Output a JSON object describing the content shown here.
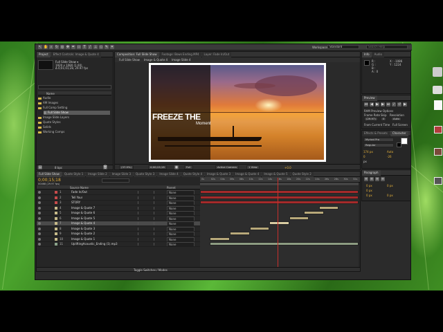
{
  "workspace": {
    "label": "Workspace:",
    "value": "Standard",
    "search_placeholder": "Search Help"
  },
  "project": {
    "tabs": [
      "Project",
      "Effect Controls: Image & Quote 4"
    ],
    "item_name": "Full Slide Show ▾",
    "item_info": [
      "1920 x 1080 (1.00)",
      "Δ 0;01;01;28, 29.97 fps"
    ],
    "search_value": "",
    "col_name": "Name",
    "items": [
      {
        "label": "Audio",
        "type": "folder",
        "indent": 0
      },
      {
        "label": "AM Images",
        "type": "folder",
        "indent": 0
      },
      {
        "label": "Full Comp Setting",
        "type": "folder",
        "indent": 0
      },
      {
        "label": "Full Slide Show",
        "type": "comp",
        "indent": 1,
        "selected": true
      },
      {
        "label": "Image Slide Layers",
        "type": "folder",
        "indent": 0
      },
      {
        "label": "Quote Styles",
        "type": "folder",
        "indent": 0
      },
      {
        "label": "Solids",
        "type": "folder",
        "indent": 0
      },
      {
        "label": "Working Comps",
        "type": "folder",
        "indent": 0
      }
    ],
    "footer": "8 bpc"
  },
  "composition": {
    "tabs": [
      "Composition: Full Slide Show",
      "Footage: Bows Ending.MP4",
      "Layer: Fade In/Out"
    ],
    "subtabs": [
      "Full Slide Show",
      "Image & Quote 4",
      "Image Slide 4"
    ],
    "headline": "FREEZE THE",
    "subline": "Moment",
    "zoom": "(37.9%)",
    "timecode": "0;00;15;18",
    "resolution": "Full",
    "camera": "Active Camera",
    "views": "1 View",
    "offset": "+0.0"
  },
  "info": {
    "tabs": [
      "Info",
      "Audio"
    ],
    "r": "R :",
    "g": "G :",
    "b": "B :",
    "a": "A : 0",
    "x": "X : -1086",
    "y": "Y : 1224"
  },
  "preview": {
    "title": "Preview",
    "ram_options": "RAM Preview Options",
    "frame_rate_label": "Frame Rate",
    "skip_label": "Skip",
    "resolution_label": "Resolution",
    "frame_rate": "(29.97)",
    "skip": "0",
    "resolution": "Auto",
    "from_current": "From Current Time",
    "full_screen": "Full Screen"
  },
  "character": {
    "tabs": [
      "Effects & Presets",
      "Character"
    ],
    "font": "Myriad Pro",
    "style": "Regular",
    "size": "174 px",
    "leading": "Auto",
    "tracking": "0",
    "tsume": "-26",
    "px_label": "px"
  },
  "paragraph": {
    "title": "Paragraph",
    "fields": [
      "0 px",
      "0 px",
      "0 px",
      "0 px",
      "0 px"
    ]
  },
  "timeline": {
    "tabs": [
      "Full Slide Show",
      "Quote Style 1",
      "Image Slide 2",
      "Image Slide 3",
      "Quote Style 3",
      "Image Slide 4",
      "Quote Style 4",
      "Image & Quote 3",
      "Image & Quote 4",
      "Image & Quote 5",
      "Quote Style 2"
    ],
    "timecode": "0;00;15;18",
    "subtimecode": "00468 (29.97 fps)",
    "col_source": "Source Name",
    "col_parent": "Parent",
    "ticks": [
      "0s",
      "02s",
      "04s",
      "06s",
      "08s",
      "10s",
      "12s",
      "14s",
      "16s",
      "18s",
      "20s",
      "22s",
      "24s",
      "26s",
      "28s",
      "30s",
      "32s"
    ],
    "layers": [
      {
        "num": "1",
        "name": "Fade In/Out",
        "parent": "None",
        "color": "#c74b4b"
      },
      {
        "num": "2",
        "name": "Tell Your",
        "parent": "None",
        "color": "#c74b4b"
      },
      {
        "num": "3",
        "name": "STORY",
        "parent": "None",
        "color": "#c74b4b"
      },
      {
        "num": "4",
        "name": "Image & Quote 7",
        "parent": "None",
        "color": "#c7bb8a"
      },
      {
        "num": "5",
        "name": "Image & Quote 6",
        "parent": "None",
        "color": "#c7bb8a"
      },
      {
        "num": "6",
        "name": "Image & Quote 5",
        "parent": "None",
        "color": "#c7bb8a"
      },
      {
        "num": "7",
        "name": "Image & Quote 4",
        "parent": "None",
        "color": "#c7bb8a"
      },
      {
        "num": "8",
        "name": "Image & Quote 3",
        "parent": "None",
        "color": "#c7bb8a"
      },
      {
        "num": "9",
        "name": "Image & Quote 2",
        "parent": "None",
        "color": "#c7bb8a"
      },
      {
        "num": "10",
        "name": "Image & Quote 1",
        "parent": "None",
        "color": "#c7bb8a"
      },
      {
        "num": "11",
        "name": "UpliftingAcoustic_Ending (1).mp3",
        "parent": "None",
        "color": "#8aa38a"
      }
    ],
    "toggle_label": "Toggle Switches / Modes"
  },
  "colors": {
    "accent": "#e8b33a",
    "playhead": "#c9302c",
    "red_bar": "#a52a2a",
    "tan_bar": "#b8a97a",
    "audio_bar": "#8d9c82"
  }
}
